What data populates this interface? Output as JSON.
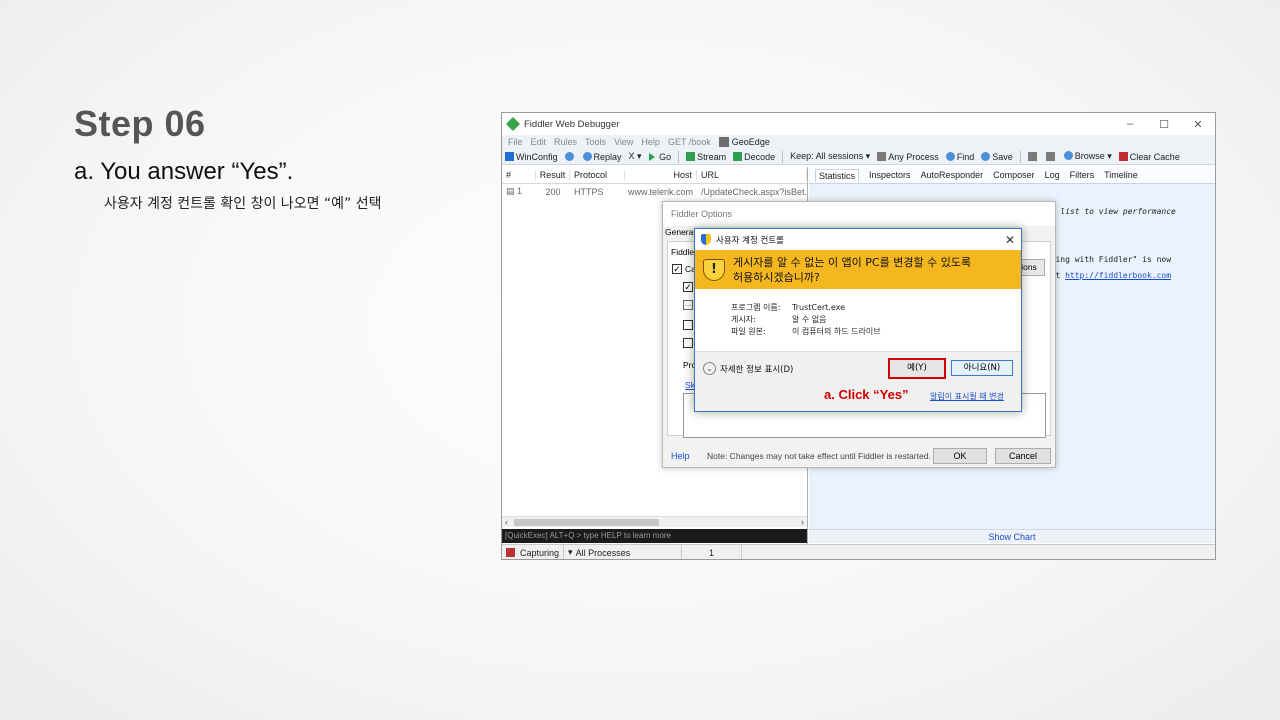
{
  "slide": {
    "title": "Step 06",
    "subtitle": "a. You answer “Yes”.",
    "note": "사용자 계정 컨트롤 확인 창이 나오면 “예” 선택"
  },
  "fiddler": {
    "title": "Fiddler Web Debugger",
    "window_controls": [
      "–",
      "☐",
      "✕"
    ],
    "menu": [
      "File",
      "Edit",
      "Rules",
      "Tools",
      "View",
      "Help",
      "GET /book"
    ],
    "geoedge": "GeoEdge",
    "toolbar": {
      "winconfig": "WinConfig",
      "replay": "Replay",
      "x_menu": "X ▾",
      "go": "Go",
      "stream": "Stream",
      "decode": "Decode",
      "keep": "Keep: All sessions ▾",
      "any_process": "Any Process",
      "find": "Find",
      "save": "Save",
      "browse": "Browse ▾",
      "clear_cache": "Clear Cache"
    },
    "sessions": {
      "columns": [
        "#",
        "Result",
        "Protocol",
        "Host",
        "URL"
      ],
      "rows": [
        {
          "num": "1",
          "result": "200",
          "protocol": "HTTPS",
          "host": "www.telerik.com",
          "url": "/UpdateCheck.aspx?isBet..."
        }
      ]
    },
    "quickexec": "[QuickExec] ALT+Q > type HELP to learn more",
    "tabs": [
      "Statistics",
      "Inspectors",
      "AutoResponder",
      "Composer",
      "Log",
      "Filters",
      "Timeline"
    ],
    "right_text": {
      "line1": "ons list to view performance",
      "line2": "ugging with Fiddler\" is now",
      "line3_prefix": "k at ",
      "line3_link": "http://fiddlerbook.com"
    },
    "show_chart": "Show Chart",
    "status": {
      "capturing": "Capturing",
      "processes": "All Processes",
      "count": "1"
    }
  },
  "options_dialog": {
    "title": "Fiddler Options",
    "tab": "General",
    "panel_labels": {
      "fiddler": "Fiddler",
      "capture": "Ca",
      "protocols": "Pro",
      "skip": "Sk",
      "tbtn": "ions"
    },
    "help": "Help",
    "note": "Note: Changes may not take effect until Fiddler is restarted.",
    "ok": "OK",
    "cancel": "Cancel"
  },
  "uac_dialog": {
    "title": "사용자 계정 컨트롤",
    "close": "✕",
    "message_line1": "게시자를 알 수 없는 이 앱이 PC를 변경할 수 있도록",
    "message_line2": "허용하시겠습니까?",
    "program_label": "프로그램 이름:",
    "program_value": "TrustCert.exe",
    "publisher_label": "게시자:",
    "publisher_value": "알 수 없음",
    "origin_label": "파일 원본:",
    "origin_value": "이 컴퓨터의 하드 드라이브",
    "details": "자세한 정보 표시(D)",
    "yes": "예(Y)",
    "no": "아니요(N)",
    "change_link": "알림이 표시될 때 변경"
  },
  "annotation": {
    "click_yes": "a. Click “Yes”",
    "color": "#d40000"
  }
}
